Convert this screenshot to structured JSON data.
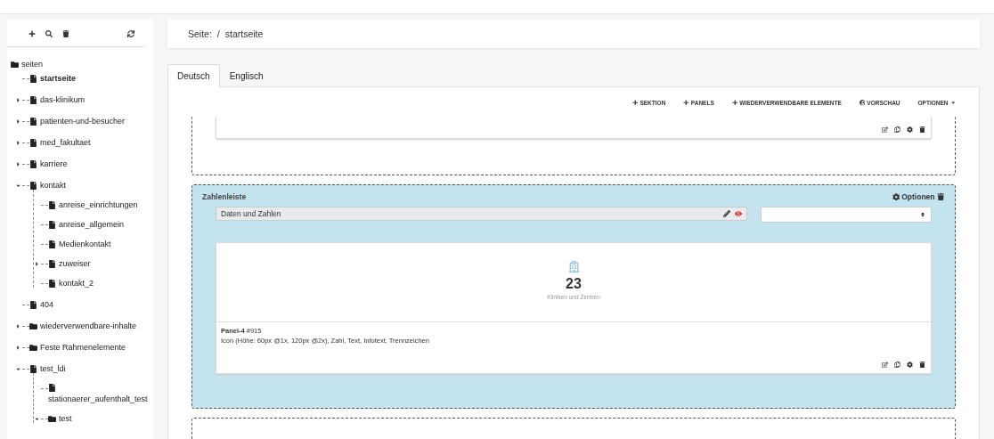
{
  "sidebar": {
    "tree": [
      {
        "label": "seiten",
        "kind": "folder",
        "selected": false,
        "children": [
          {
            "label": "startseite",
            "kind": "page",
            "selected": true
          },
          {
            "label": "das-klinikum",
            "kind": "page",
            "expanded": false,
            "selected": false
          },
          {
            "label": "patienten-und-besucher",
            "kind": "page",
            "expanded": false,
            "selected": false
          },
          {
            "label": "med_fakultaet",
            "kind": "page",
            "expanded": false,
            "selected": false
          },
          {
            "label": "karriere",
            "kind": "page",
            "expanded": false,
            "selected": false
          },
          {
            "label": "kontakt",
            "kind": "page",
            "expanded": true,
            "selected": false,
            "children": [
              {
                "label": "anreise_einrichtungen",
                "kind": "page",
                "selected": false
              },
              {
                "label": "anreise_allgemein",
                "kind": "page",
                "selected": false
              },
              {
                "label": "Medienkontakt",
                "kind": "page",
                "selected": false
              },
              {
                "label": "zuweiser",
                "kind": "page",
                "expanded": false,
                "selected": false
              },
              {
                "label": "kontakt_2",
                "kind": "page",
                "selected": false
              }
            ]
          },
          {
            "label": "404",
            "kind": "page",
            "selected": false
          },
          {
            "label": "wiederverwendbare-inhalte",
            "kind": "folder",
            "expanded": false,
            "selected": false
          },
          {
            "label": "Feste Rahmenelemente",
            "kind": "folder",
            "expanded": false,
            "selected": false
          },
          {
            "label": "test_ldi",
            "kind": "page",
            "expanded": true,
            "selected": false,
            "children": [
              {
                "label": "stationaerer_aufenthalt_test",
                "kind": "page",
                "selected": false
              },
              {
                "label": "test",
                "kind": "folder",
                "expanded": true,
                "selected": false
              }
            ]
          }
        ]
      }
    ]
  },
  "breadcrumb": {
    "label": "Seite:",
    "separator": "/",
    "page": "startseite"
  },
  "tabs": [
    {
      "label": "Deutsch",
      "selected": true
    },
    {
      "label": "Englisch",
      "selected": false
    }
  ],
  "toolbar": [
    {
      "label": "SEKTION",
      "kind": "plus"
    },
    {
      "label": "PANELS",
      "kind": "plus"
    },
    {
      "label": "WIEDERVERWENDBARE ELEMENTE",
      "kind": "plus"
    },
    {
      "label": "VORSCHAU",
      "kind": "globe"
    },
    {
      "label": "OPTIONEN",
      "kind": "menu"
    }
  ],
  "sections": [
    {
      "highlighted": false,
      "panels": [
        {
          "kind": "footer_only"
        }
      ]
    },
    {
      "highlighted": true,
      "title": "Zahlenleiste",
      "options": "Optionen",
      "name_field": {
        "value": "Daten und Zahlen",
        "visible": true
      },
      "panels": [
        {
          "kind": "number",
          "number": "23",
          "caption": "Kliniken und Zentren",
          "name": "Panel-4",
          "id": "#915",
          "description": "Icon (Höhe: 60px @1x, 120px @2x), Zahl, Text, Infotext, Trennzeichen"
        }
      ]
    },
    {
      "highlighted": false
    }
  ]
}
